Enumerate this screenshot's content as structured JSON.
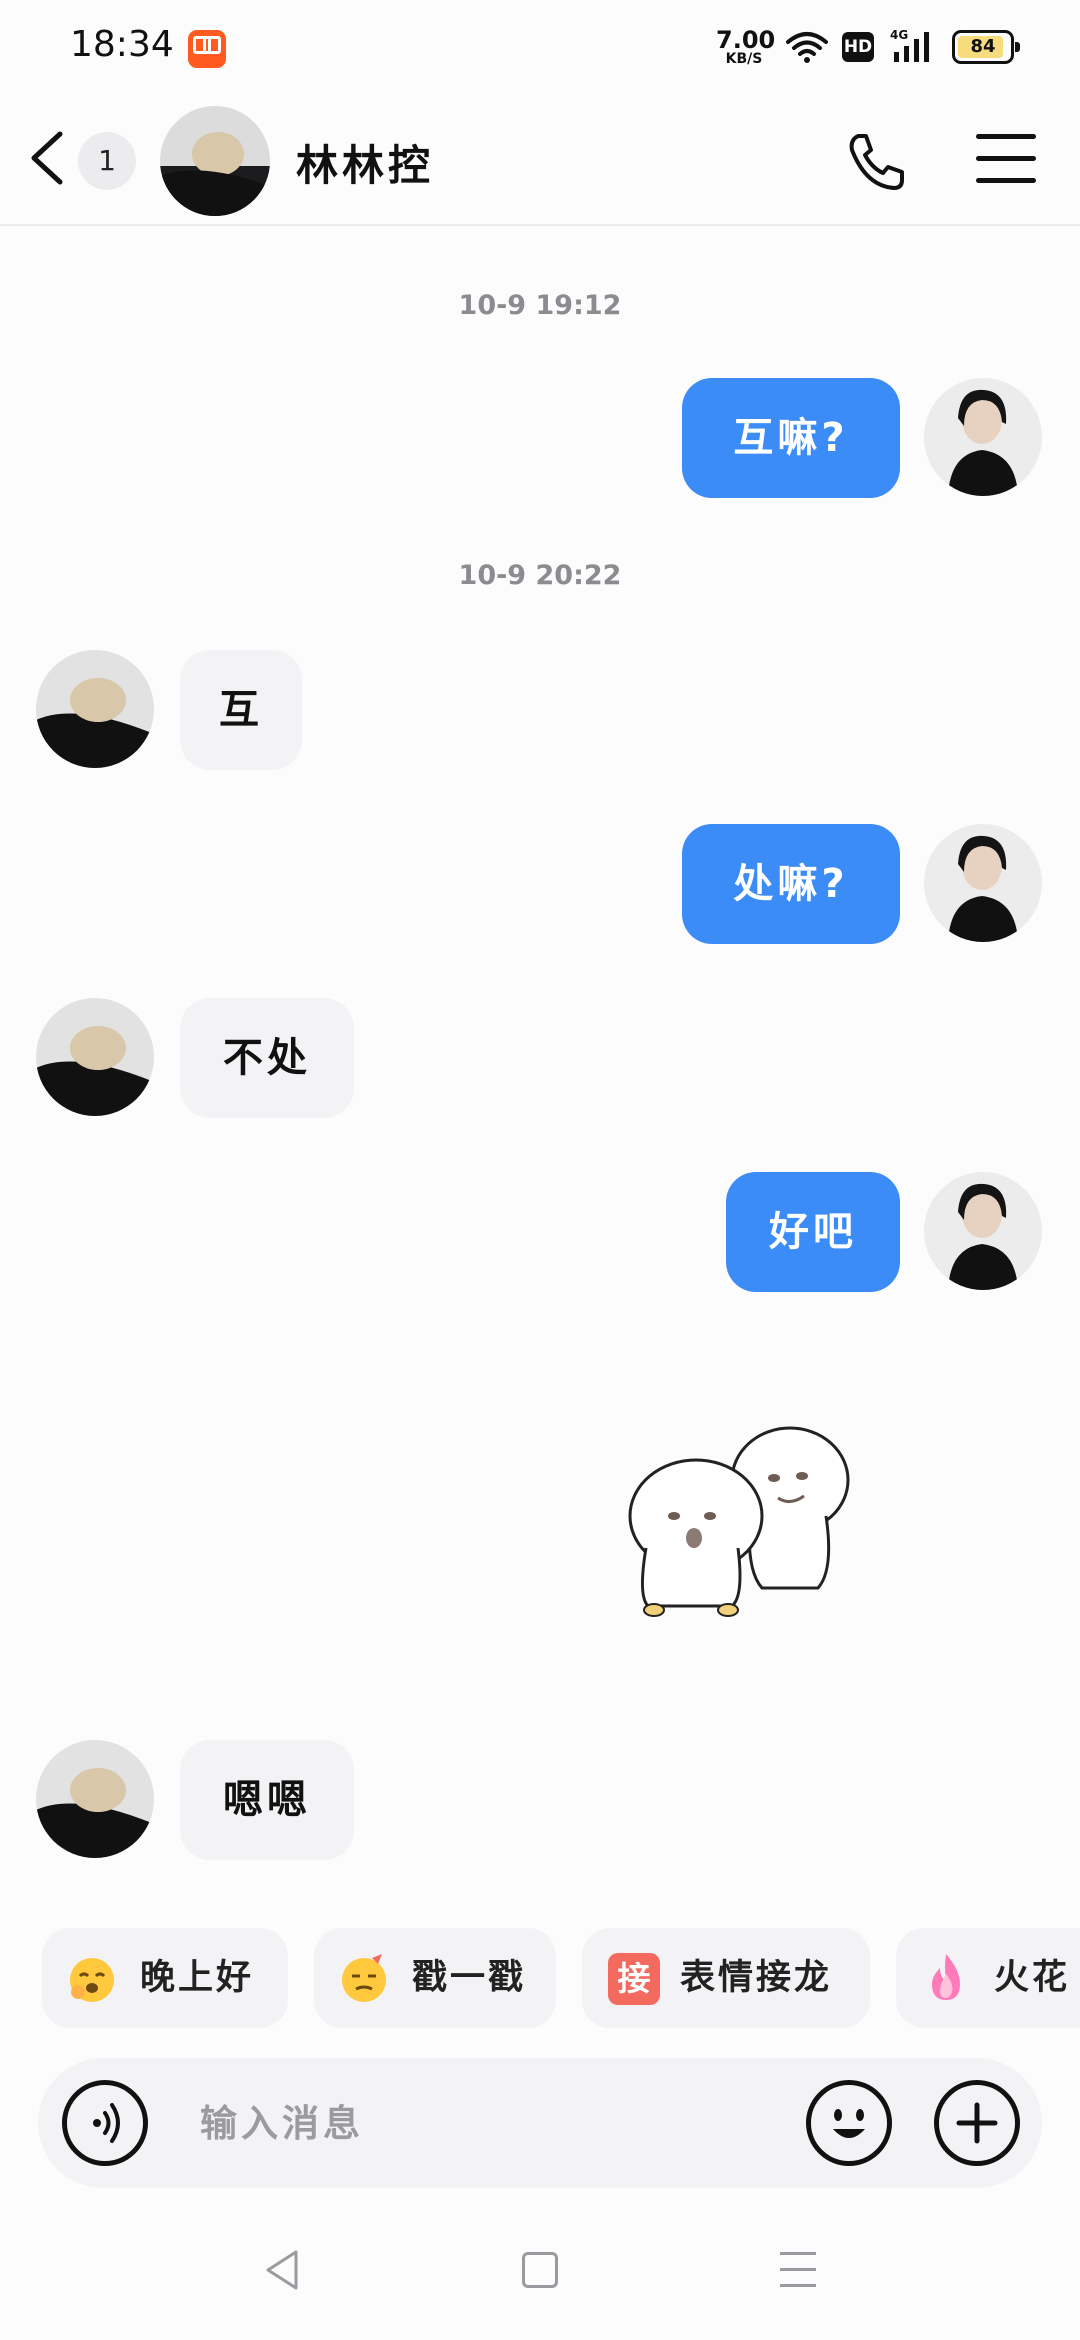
{
  "status_bar": {
    "time": "18:34",
    "net_speed_value": "7.00",
    "net_speed_unit": "KB/S",
    "hd_label": "HD",
    "network_type": "4G",
    "battery_percent": "84"
  },
  "header": {
    "unread_count": "1",
    "contact_name": "林林控"
  },
  "messages": [
    {
      "type": "timestamp",
      "text": "10-9  19:12"
    },
    {
      "type": "outgoing",
      "text": "互嘛?"
    },
    {
      "type": "timestamp",
      "text": "10-9  20:22"
    },
    {
      "type": "incoming",
      "text": "互"
    },
    {
      "type": "outgoing",
      "text": "处嘛?"
    },
    {
      "type": "incoming",
      "text": "不处"
    },
    {
      "type": "outgoing",
      "text": "好吧"
    },
    {
      "type": "outgoing_sticker",
      "sticker": "two-buddies-sticker"
    },
    {
      "type": "incoming",
      "text": "嗯嗯"
    }
  ],
  "quick_replies": [
    {
      "label": "晚上好",
      "icon": "yawn-emoji-icon"
    },
    {
      "label": "戳一戳",
      "icon": "poke-emoji-icon"
    },
    {
      "label": "表情接龙",
      "icon_text": "接"
    },
    {
      "label": "火花",
      "icon": "flame-icon"
    }
  ],
  "input": {
    "placeholder": "输入消息"
  },
  "colors": {
    "outgoing_bubble": "#3b8cf6",
    "incoming_bubble": "#f3f3f6",
    "timestamp_text": "#8b8b90"
  }
}
